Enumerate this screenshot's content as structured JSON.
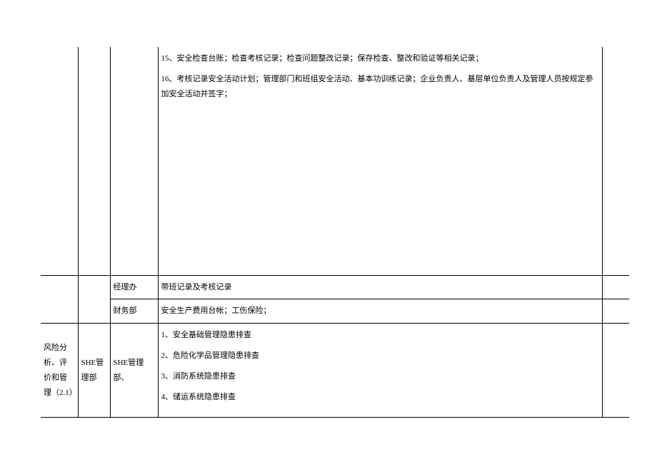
{
  "rows": {
    "r1": {
      "content": {
        "p1": "15、安全检查台账；检查考核记录；检查问题整改记录；保存检查、整改和验证等相关记录；",
        "p2": "16、考核记录安全活动计划；管理部门和班组安全活动、基本功训练记录；企业负责人、基层单位负责人及管理人员按规定参加安全活动并签字；"
      }
    },
    "r2": {
      "dept": "经理办",
      "content": "带班记录及考核记录"
    },
    "r3": {
      "dept": "财务部",
      "content": "安全生产费用台帐；工伤保险；"
    },
    "r4": {
      "cat": "风险分析、评价和管理（2.1）",
      "owner": "SHE管理部",
      "dept": "SHE管理部、",
      "content": {
        "p1": "1、安全基础管理隐患排查",
        "p2": "2、危险化学品管理隐患排查",
        "p3": "3、消防系统隐患排查",
        "p4": "4、储运系统隐患排查"
      }
    }
  }
}
